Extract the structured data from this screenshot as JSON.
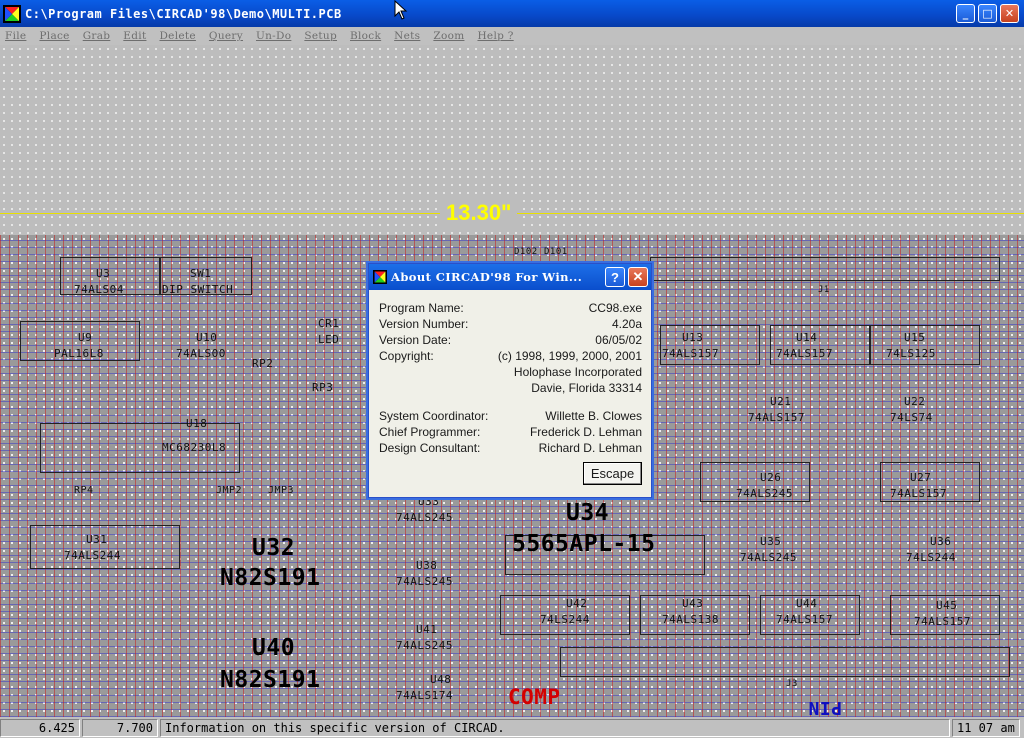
{
  "window": {
    "title": "C:\\Program Files\\CIRCAD'98\\Demo\\MULTI.PCB",
    "min": "_",
    "max": "□",
    "close": "✕"
  },
  "menu": [
    "File",
    "Place",
    "Grab",
    "Edit",
    "Delete",
    "Query",
    "Un-Do",
    "Setup",
    "Block",
    "Nets",
    "Zoom",
    "Help ?"
  ],
  "canvas": {
    "dimension": "13.30\"",
    "labels": {
      "d102": "D102",
      "d101": "D101",
      "u3": "U3",
      "u3p": "74ALS04",
      "sw1": "SW1",
      "sw1p": "DIP SWITCH",
      "u9": "U9",
      "u9p": "PAL16L8",
      "u10": "U10",
      "u10p": "74ALS00",
      "cr1": "CR1",
      "cr1p": "LED",
      "rp2": "RP2",
      "rp3": "RP3",
      "u18": "U18",
      "u18p": "MC68230L8",
      "rp4": "RP4",
      "jmp2": "JMP2",
      "jmp3": "JMP3",
      "u31": "U31",
      "u31p": "74ALS244",
      "u32": "U32",
      "u32p": "N82S191",
      "u40": "U40",
      "u40p": "N82S191",
      "u33": "U33",
      "u33p": "74ALS245",
      "u38": "U38",
      "u38p": "74ALS245",
      "u41": "U41",
      "u41p": "74ALS245",
      "u48": "U48",
      "u48p": "74ALS174",
      "u34": "U34",
      "u34p": "5565APL-15",
      "u42": "U42",
      "u42p": "74LS244",
      "u43": "U43",
      "u43p": "74ALS138",
      "u44": "U44",
      "u44p": "74ALS157",
      "u13": "U13",
      "u13p": "74ALS157",
      "u14": "U14",
      "u14p": "74ALS157",
      "u15": "U15",
      "u15p": "74LS125",
      "u21": "U21",
      "u21p": "74ALS157",
      "u22": "U22",
      "u22p": "74LS74",
      "u26": "U26",
      "u26p": "74ALS245",
      "u27": "U27",
      "u27p": "74ALS157",
      "u35": "U35",
      "u35p": "74ALS245",
      "u36": "U36",
      "u36p": "74LS244",
      "u45": "U45",
      "u45p": "74ALS157",
      "j1": "J1",
      "j3": "J3",
      "comp": "COMP",
      "pin": "PIN"
    }
  },
  "about": {
    "title": "About CIRCAD'98 For Win...",
    "help": "?",
    "close": "✕",
    "program_name_label": "Program Name:",
    "program_name": "CC98.exe",
    "version_number_label": "Version Number:",
    "version_number": "4.20a",
    "version_date_label": "Version Date:",
    "version_date": "06/05/02",
    "copyright_label": "Copyright:",
    "copyright_1": "(c) 1998, 1999, 2000, 2001",
    "copyright_2": "Holophase Incorporated",
    "copyright_3": "Davie, Florida  33314",
    "system_coordinator_label": "System Coordinator:",
    "system_coordinator": "Willette B. Clowes",
    "chief_programmer_label": "Chief Programmer:",
    "chief_programmer": "Frederick D. Lehman",
    "design_consultant_label": "Design Consultant:",
    "design_consultant": "Richard D. Lehman",
    "escape": "Escape"
  },
  "status": {
    "x": "6.425",
    "y": "7.700",
    "message": "Information on this specific version of CIRCAD.",
    "time": "11 07 am"
  }
}
